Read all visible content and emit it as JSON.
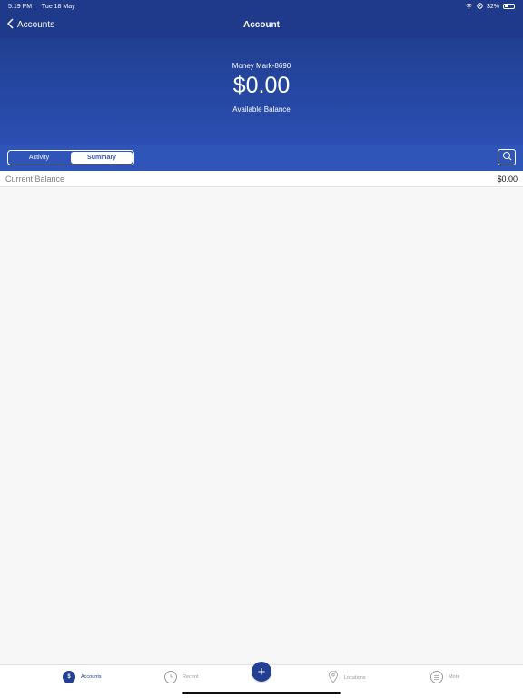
{
  "status_bar": {
    "time": "5:19 PM",
    "date": "Tue 18 May",
    "battery": "32%"
  },
  "nav": {
    "back_label": "Accounts",
    "title": "Account"
  },
  "account": {
    "name": "Money Mark-8690",
    "balance": "$0.00",
    "balance_label": "Available Balance"
  },
  "segments": {
    "activity": "Activity",
    "summary": "Summary",
    "active": "Summary"
  },
  "summary": {
    "rows": [
      {
        "label": "Current Balance",
        "value": "$0.00"
      }
    ]
  },
  "tabs": [
    {
      "label": "Accounts",
      "icon": "dollar-icon",
      "active": true
    },
    {
      "label": "Recent",
      "icon": "clock-icon",
      "active": false
    },
    {
      "label": "+",
      "icon": "plus-icon",
      "active": false
    },
    {
      "label": "Locations",
      "icon": "location-pin-icon",
      "active": false
    },
    {
      "label": "More",
      "icon": "menu-icon",
      "active": false
    }
  ],
  "colors": {
    "primary": "#1f3a8a",
    "secondary": "#2f55b8",
    "background": "#f7f7f7"
  }
}
